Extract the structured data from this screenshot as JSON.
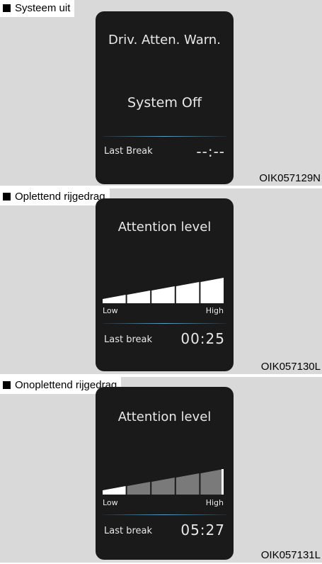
{
  "panels": [
    {
      "tab_label": "Systeem uit",
      "code": "OIK057129N",
      "screen": {
        "heading": "Driv. Atten. Warn.",
        "message": "System Off",
        "last_break_label": "Last Break",
        "last_break_value": "--:--"
      }
    },
    {
      "tab_label": "Oplettend rijgedrag",
      "code": "OIK057130L",
      "screen": {
        "heading": "Attention level",
        "low_label": "Low",
        "high_label": "High",
        "level": 5,
        "max_level": 5,
        "last_break_label": "Last break",
        "last_break_value": "00:25"
      }
    },
    {
      "tab_label": "Onoplettend rijgedrag",
      "code": "OIK057131L",
      "screen": {
        "heading": "Attention level",
        "low_label": "Low",
        "high_label": "High",
        "level": 1,
        "max_level": 5,
        "last_break_label": "Last break",
        "last_break_value": "05:27"
      }
    }
  ],
  "colors": {
    "panel_bg": "#d9d9d9",
    "screen_bg": "#1a1a1a",
    "bar_active": "#ffffff",
    "bar_inactive": "#7a7a7a",
    "divider": "#5aa0c8"
  }
}
